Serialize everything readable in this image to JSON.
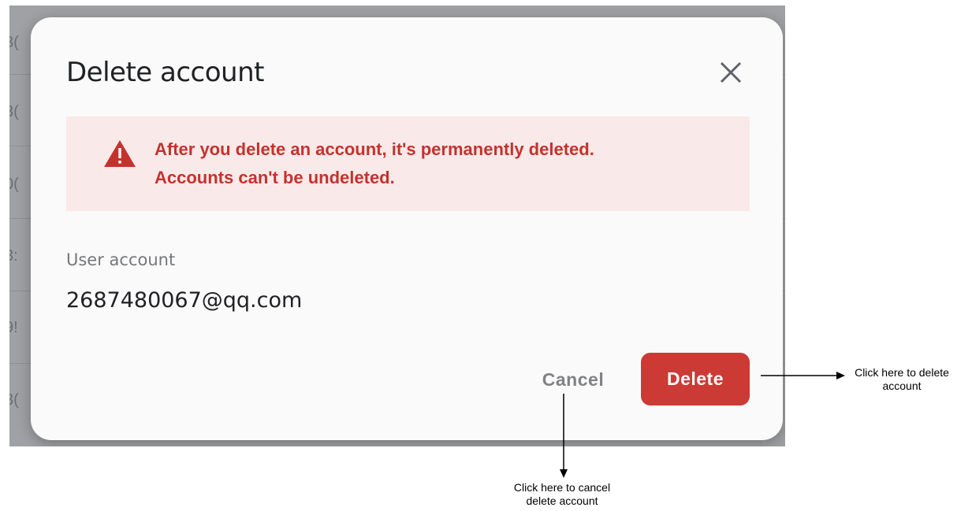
{
  "background_fragments": [
    "3(",
    "3(",
    "0(",
    "3:",
    "9!",
    "3("
  ],
  "dialog": {
    "title": "Delete account",
    "close_icon": "close-icon",
    "alert": {
      "icon": "warning-triangle-icon",
      "color": "#c5322d",
      "background": "#fae9e9",
      "line1": "After you delete an account, it's permanently deleted.",
      "line2": "Accounts can't be undeleted."
    },
    "field_label": "User account",
    "field_value": "2687480067@qq.com",
    "cancel_label": "Cancel",
    "delete_label": "Delete",
    "delete_color": "#cc3a36"
  },
  "annotations": {
    "delete": {
      "line1": "Click here to delete",
      "line2": "account"
    },
    "cancel": {
      "line1": "Click here to cancel",
      "line2": "delete account"
    }
  }
}
